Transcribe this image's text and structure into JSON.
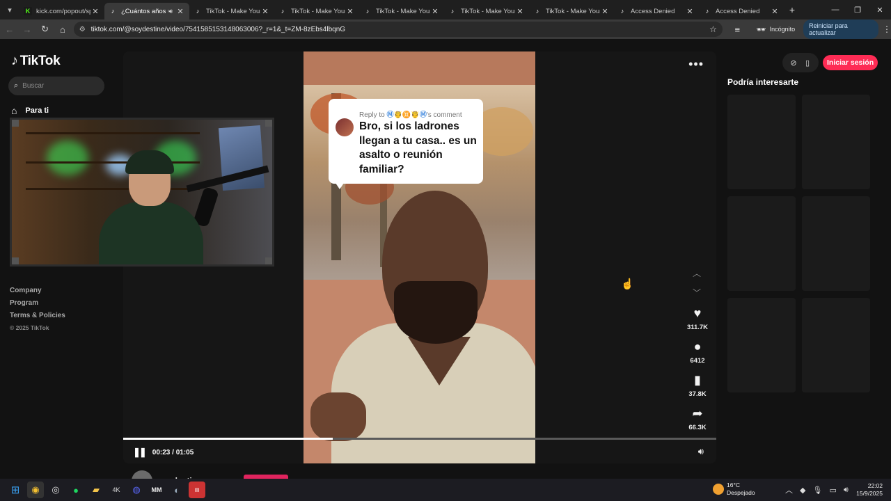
{
  "browser": {
    "tabs": [
      {
        "label": "kick.com/popout/sp...",
        "icon": "kick-icon",
        "active": false,
        "audio": false
      },
      {
        "label": "¿Cuántos años te...",
        "icon": "tiktok-icon",
        "active": true,
        "audio": true
      },
      {
        "label": "TikTok - Make Your D...",
        "icon": "tiktok-icon",
        "active": false,
        "audio": false
      },
      {
        "label": "TikTok - Make Your D...",
        "icon": "tiktok-icon",
        "active": false,
        "audio": false
      },
      {
        "label": "TikTok - Make Your D...",
        "icon": "tiktok-icon",
        "active": false,
        "audio": false
      },
      {
        "label": "TikTok - Make Your D...",
        "icon": "tiktok-icon",
        "active": false,
        "audio": false
      },
      {
        "label": "TikTok - Make Your D...",
        "icon": "tiktok-icon",
        "active": false,
        "audio": false
      },
      {
        "label": "Access Denied",
        "icon": "tiktok-icon",
        "active": false,
        "audio": false
      },
      {
        "label": "Access Denied",
        "icon": "tiktok-icon",
        "active": false,
        "audio": false
      }
    ],
    "url": "tiktok.com/@soydestine/video/7541585153148063006?_r=1&_t=ZM-8zEbs4lbqnG",
    "incognito_label": "Incógnito",
    "restart_label": "Reiniciar para actualizar"
  },
  "sidebar": {
    "logo": "TikTok",
    "search_placeholder": "Buscar",
    "nav_for_you": "Para ti",
    "links": [
      "Company",
      "Program",
      "Terms & Policies"
    ],
    "copyright": "© 2025 TikTok"
  },
  "video": {
    "reply_prefix": "Reply to",
    "reply_user": "Ⓜ🤴♊🤴Ⓜ",
    "reply_suffix": "'s comment",
    "comment": "Bro, si los ladrones llegan a tu casa.. es un asalto o reunión familiar?",
    "time": "00:23 / 01:05",
    "progress": 0.3538,
    "likes": "311.7K",
    "comments": "6412",
    "saves": "37.8K",
    "shares": "66.3K",
    "author": "soydestine"
  },
  "rail": {
    "login_label": "Iniciar sesión",
    "suggest_title": "Podría interesarte"
  },
  "taskbar": {
    "temp": "16°C",
    "weather": "Despejado",
    "time": "22:02",
    "date": "15/9/2025"
  },
  "colors": {
    "brand": "#fe2c55",
    "background": "#121212"
  }
}
